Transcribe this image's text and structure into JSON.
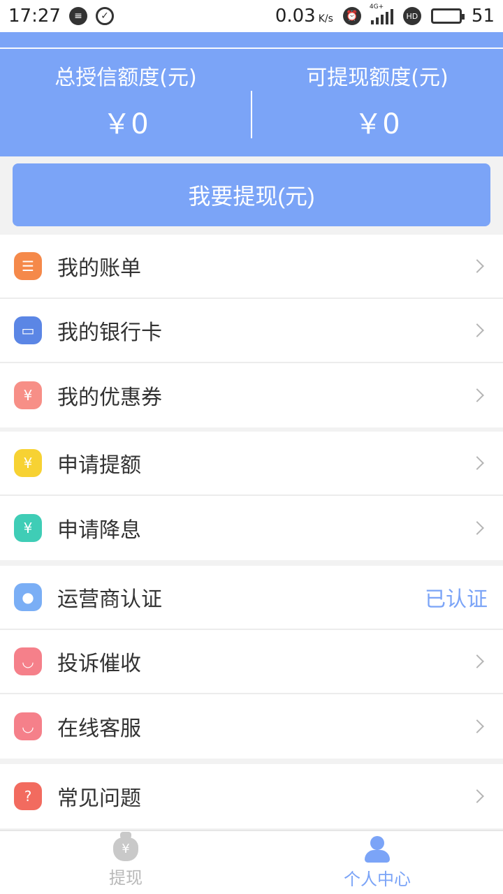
{
  "status_bar": {
    "time": "17:27",
    "speed": "0.03",
    "speed_unit": "K/s",
    "network": "4G+",
    "battery": "51"
  },
  "header": {
    "total_credit_label": "总授信额度(元)",
    "total_credit_value": "￥0",
    "withdrawable_label": "可提现额度(元)",
    "withdrawable_value": "￥0",
    "background_color": "#7ba4f7"
  },
  "withdraw_button": {
    "label": "我要提现(元)"
  },
  "menu_groups": [
    {
      "items": [
        {
          "label": "我的账单",
          "icon": "bill-icon",
          "color": "#f5894a"
        },
        {
          "label": "我的银行卡",
          "icon": "bank-card-icon",
          "color": "#5b86e5"
        },
        {
          "label": "我的优惠券",
          "icon": "coupon-icon",
          "color": "#f78f87"
        }
      ]
    },
    {
      "items": [
        {
          "label": "申请提额",
          "icon": "money-bag-icon",
          "color": "#f7d233"
        },
        {
          "label": "申请降息",
          "icon": "money-bag-icon",
          "color": "#3fcdb6"
        }
      ]
    },
    {
      "items": [
        {
          "label": "运营商认证",
          "icon": "verified-user-icon",
          "color": "#7aaef5",
          "status": "已认证"
        },
        {
          "label": "投诉催收",
          "icon": "chat-bubble-icon",
          "color": "#f5808a"
        },
        {
          "label": "在线客服",
          "icon": "chat-bubble-icon",
          "color": "#f5808a"
        }
      ]
    },
    {
      "items": [
        {
          "label": "常见问题",
          "icon": "question-icon",
          "color": "#f26b5f"
        }
      ]
    }
  ],
  "bottom_nav": {
    "tabs": [
      {
        "label": "提现",
        "icon": "money-bag-icon",
        "active": false
      },
      {
        "label": "个人中心",
        "icon": "user-icon",
        "active": true
      }
    ]
  }
}
